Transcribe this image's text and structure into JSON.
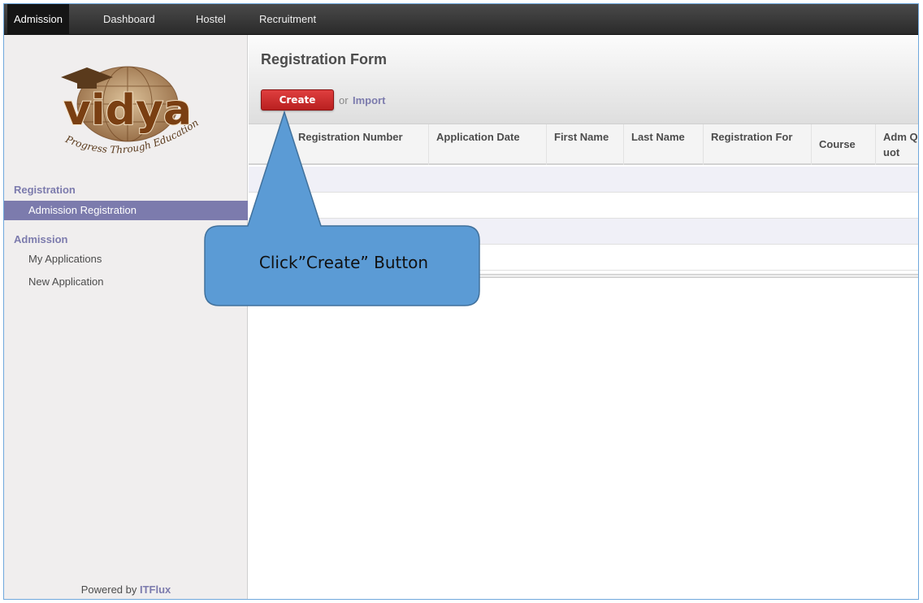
{
  "topbar": {
    "menu": [
      "Admission",
      "Dashboard",
      "Hostel",
      "Recruitment"
    ],
    "active": "Admission"
  },
  "sidebar": {
    "logo": {
      "name": "vidya",
      "tagline": "Progress Through Education"
    },
    "sections": [
      {
        "label": "Registration",
        "items": [
          {
            "label": "Admission Registration",
            "active": true
          }
        ]
      },
      {
        "label": "Admission",
        "items": [
          {
            "label": "My Applications"
          },
          {
            "label": "New Application"
          }
        ]
      }
    ],
    "powered_by_prefix": "Powered by",
    "powered_by_brand": "ITFlux"
  },
  "main": {
    "title": "Registration Form",
    "create_label": "Create",
    "or_label": "or",
    "import_label": "Import",
    "columns": [
      {
        "label": "Registration Number"
      },
      {
        "label": "Application Date"
      },
      {
        "label": "First Name"
      },
      {
        "label": "Last Name"
      },
      {
        "label": "Registration For"
      },
      {
        "label": "Course"
      },
      {
        "label": "Adm Quot"
      }
    ]
  },
  "callout": {
    "text": "Click”Create” Button",
    "color": "#5b9bd5"
  },
  "colors": {
    "accent": "#7c7bad",
    "create_button": "#c42c2c",
    "topbar": "#3a3a3a"
  }
}
